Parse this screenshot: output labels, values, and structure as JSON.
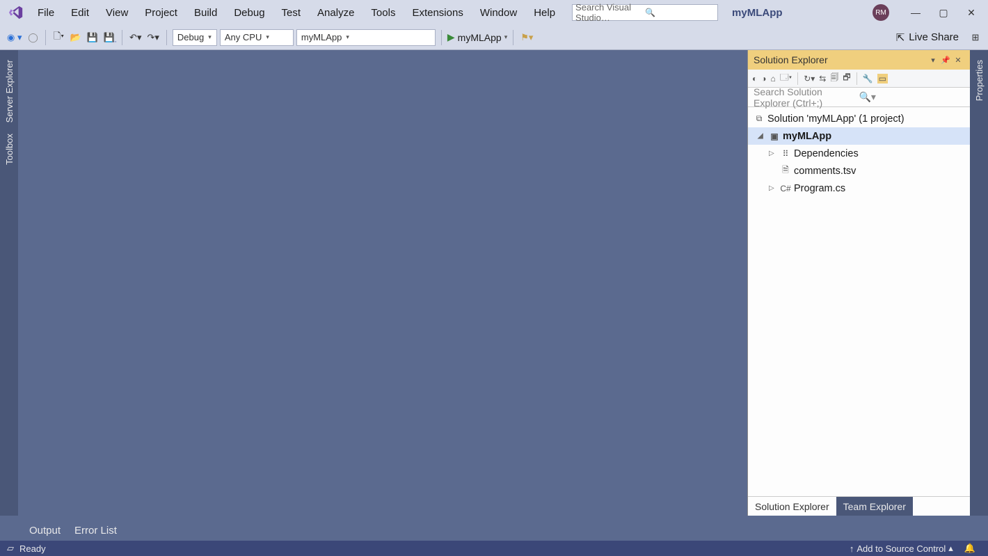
{
  "menu": [
    "File",
    "Edit",
    "View",
    "Project",
    "Build",
    "Debug",
    "Test",
    "Analyze",
    "Tools",
    "Extensions",
    "Window",
    "Help"
  ],
  "search_placeholder": "Search Visual Studio…",
  "app_title": "myMLApp",
  "user_initials": "RM",
  "liveshare_label": "Live Share",
  "toolbar": {
    "config": "Debug",
    "platform": "Any CPU",
    "startup": "myMLApp",
    "run_target": "myMLApp"
  },
  "left_rail": [
    "Server Explorer",
    "Toolbox"
  ],
  "right_rail": [
    "Properties"
  ],
  "solution_explorer": {
    "title": "Solution Explorer",
    "search_placeholder": "Search Solution Explorer (Ctrl+;)",
    "root": "Solution 'myMLApp' (1 project)",
    "project": "myMLApp",
    "items": [
      {
        "name": "Dependencies",
        "expandable": true,
        "icon": "⠿"
      },
      {
        "name": "comments.tsv",
        "expandable": false,
        "icon": "🗎"
      },
      {
        "name": "Program.cs",
        "expandable": true,
        "icon": "C#"
      }
    ],
    "tabs": [
      "Solution Explorer",
      "Team Explorer"
    ]
  },
  "bottom_tabs": [
    "Output",
    "Error List"
  ],
  "status": {
    "ready": "Ready",
    "source_control": "Add to Source Control"
  }
}
